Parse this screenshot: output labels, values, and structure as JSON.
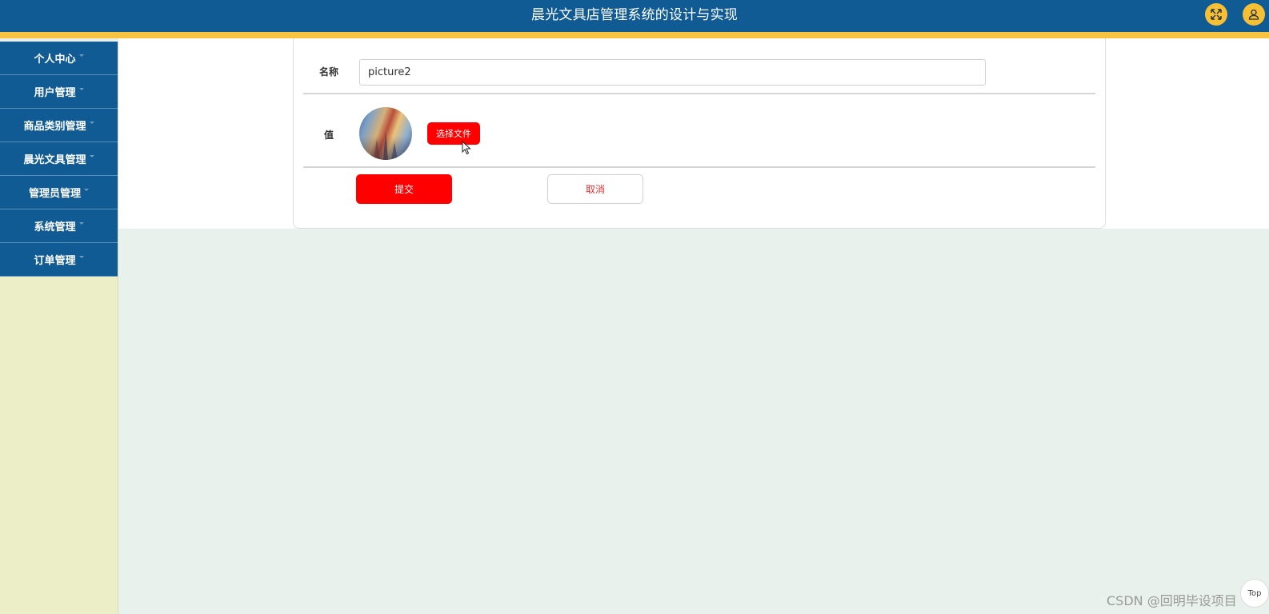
{
  "header": {
    "title": "晨光文具店管理系统的设计与实现",
    "fullscreen_icon": "fullscreen-expand-icon",
    "user_icon": "user-icon",
    "accent_color": "#f7c340",
    "bar_color": "#115b95"
  },
  "sidebar": {
    "items": [
      {
        "label": "个人中心"
      },
      {
        "label": "用户管理"
      },
      {
        "label": "商品类别管理"
      },
      {
        "label": "晨光文具管理"
      },
      {
        "label": "管理员管理"
      },
      {
        "label": "系统管理"
      },
      {
        "label": "订单管理"
      }
    ]
  },
  "form": {
    "name_label": "名称",
    "name_value": "picture2",
    "value_label": "值",
    "choose_file_label": "选择文件",
    "submit_label": "提交",
    "cancel_label": "取消"
  },
  "footer": {
    "watermark": "CSDN @回明毕设项目",
    "top_label": "Top"
  }
}
